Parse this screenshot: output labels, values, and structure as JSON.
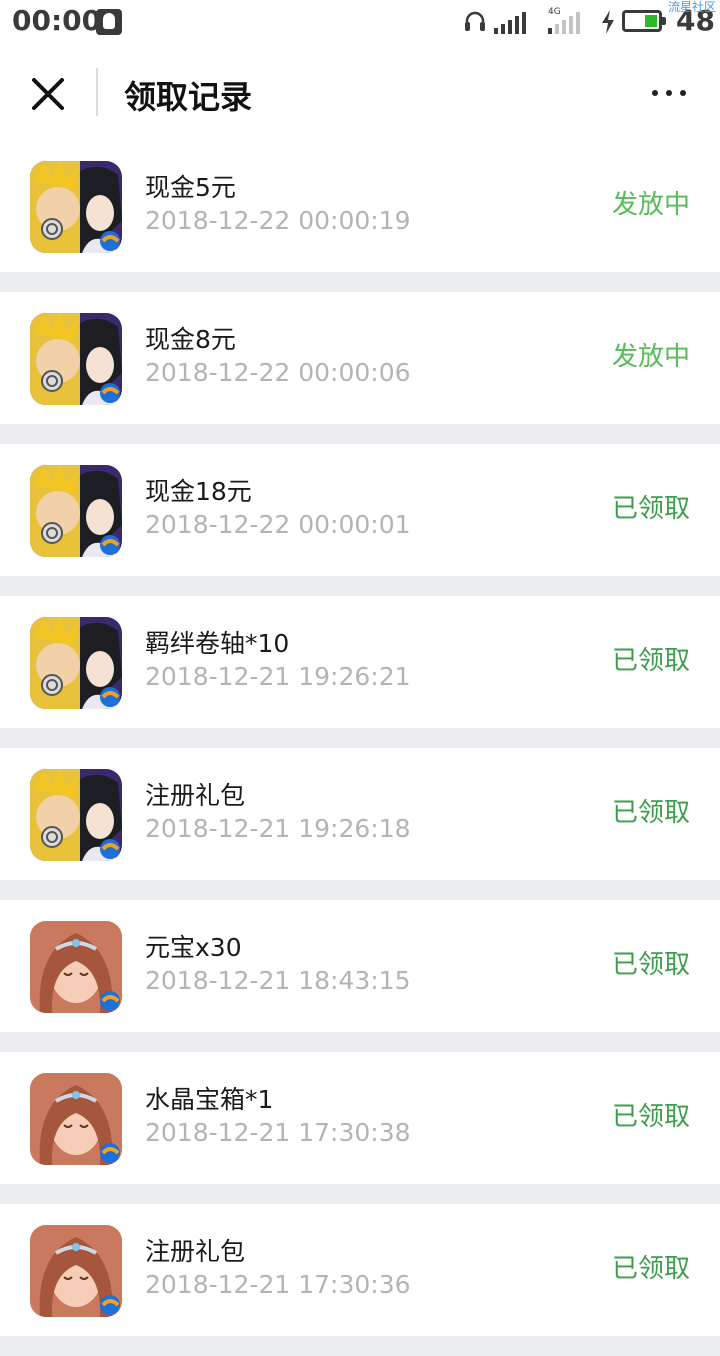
{
  "status_bar": {
    "time": "00:00",
    "network": "4G",
    "battery_level": "48",
    "watermark": "流星社区"
  },
  "nav": {
    "title": "领取记录",
    "close_icon": "close-icon",
    "more_icon": "more-icon"
  },
  "colors": {
    "pending_status": "#57bb57",
    "claimed_status": "#3e9e4d",
    "time_text": "#b4b4b4",
    "background": "#ebedf0"
  },
  "records": [
    {
      "title": "现金5元",
      "time": "2018-12-22 00:00:19",
      "status": "发放中",
      "game_icon": "ninja-game-icon"
    },
    {
      "title": "现金8元",
      "time": "2018-12-22 00:00:06",
      "status": "发放中",
      "game_icon": "ninja-game-icon"
    },
    {
      "title": "现金18元",
      "time": "2018-12-22 00:00:01",
      "status": "已领取",
      "game_icon": "ninja-game-icon"
    },
    {
      "title": "羁绊卷轴*10",
      "time": "2018-12-21 19:26:21",
      "status": "已领取",
      "game_icon": "ninja-game-icon"
    },
    {
      "title": "注册礼包",
      "time": "2018-12-21 19:26:18",
      "status": "已领取",
      "game_icon": "ninja-game-icon"
    },
    {
      "title": "元宝x30",
      "time": "2018-12-21 18:43:15",
      "status": "已领取",
      "game_icon": "fantasy-game-icon"
    },
    {
      "title": "水晶宝箱*1",
      "time": "2018-12-21 17:30:38",
      "status": "已领取",
      "game_icon": "fantasy-game-icon"
    },
    {
      "title": "注册礼包",
      "time": "2018-12-21 17:30:36",
      "status": "已领取",
      "game_icon": "fantasy-game-icon"
    }
  ]
}
